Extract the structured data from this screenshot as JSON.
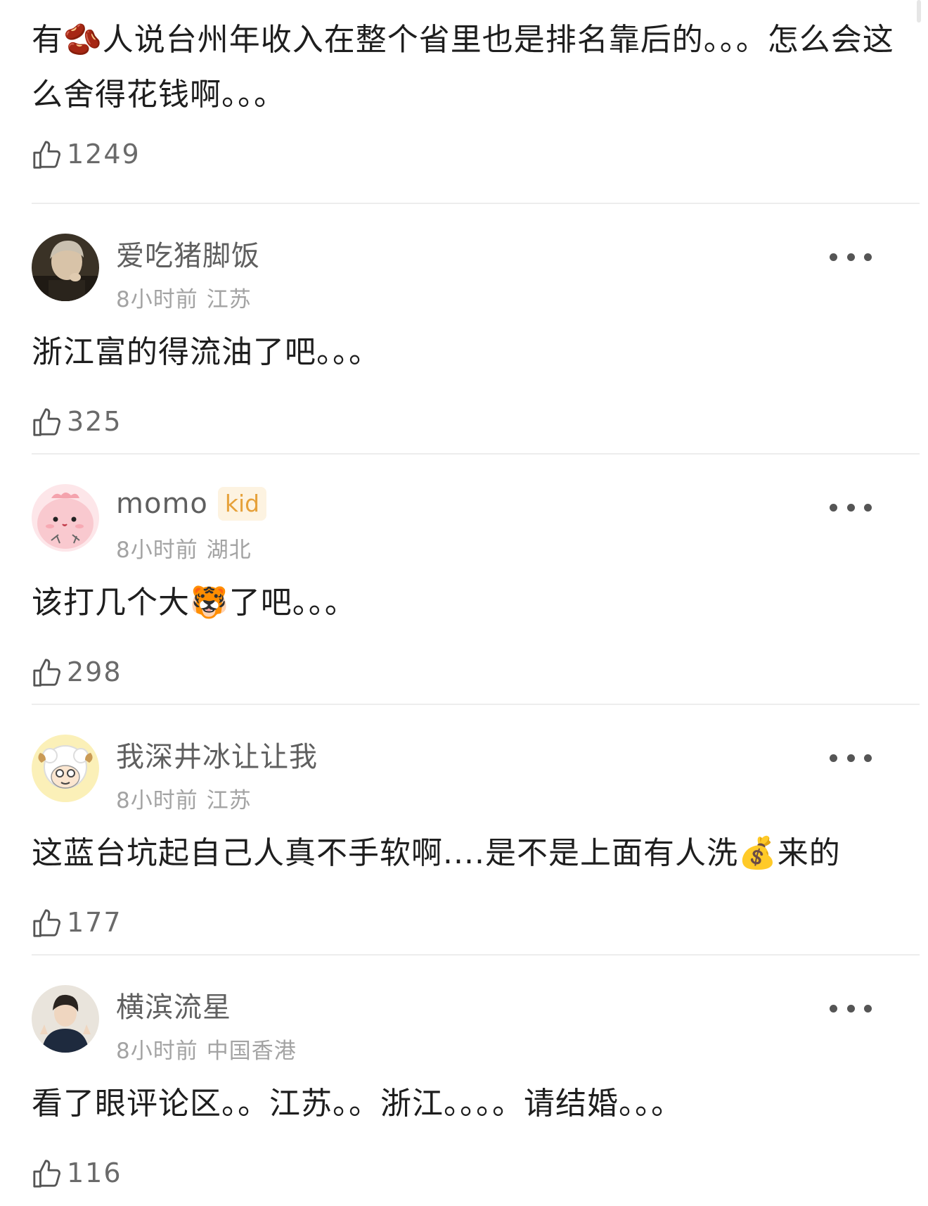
{
  "comments": [
    {
      "content": "有🫘人说台州年收入在整个省里也是排名靠后的。。。怎么会这么舍得花钱啊。。。",
      "likes": "1249"
    },
    {
      "username": "爱吃猪脚饭",
      "time": "8小时前",
      "location": "江苏",
      "avatar_icon": "avatar-photo-icon",
      "content": "浙江富的得流油了吧。。。",
      "likes": "325"
    },
    {
      "username": "momo",
      "badge": "kid",
      "time": "8小时前",
      "location": "湖北",
      "avatar_icon": "avatar-cartoon-pink-icon",
      "content": "该打几个大🐯了吧。。。",
      "likes": "298"
    },
    {
      "username": "我深井冰让让我",
      "time": "8小时前",
      "location": "江苏",
      "avatar_icon": "avatar-sheep-icon",
      "content": "这蓝台坑起自己人真不手软啊....是不是上面有人洗💰来的",
      "likes": "177"
    },
    {
      "username": "横滨流星",
      "time": "8小时前",
      "location": "中国香港",
      "avatar_icon": "avatar-photo-icon",
      "content": "看了眼评论区。。江苏。。浙江。。。。请结婚。。。",
      "likes": "116"
    }
  ],
  "colors": {
    "username": "#5f5f5f",
    "meta": "#a3a3a3",
    "badge_bg": "#fdf3e1",
    "badge_text": "#e6a13a",
    "divider": "#ededed"
  },
  "icons": {
    "like": "thumbs-up-icon",
    "more": "more-dots-icon"
  }
}
